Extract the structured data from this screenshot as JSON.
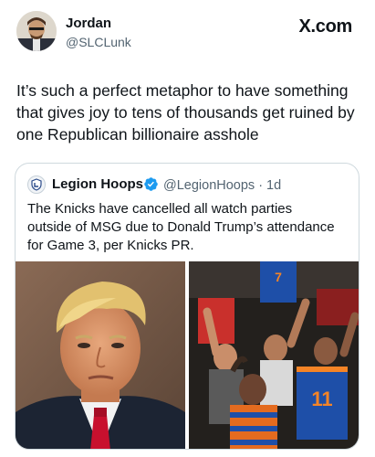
{
  "header": {
    "name": "Jordan",
    "handle": "@SLCLunk",
    "brand": "X.com"
  },
  "post": {
    "text": "It’s such a perfect metaphor to have something that gives joy to tens of thousands get ruined by one Republican billionaire asshole"
  },
  "quote": {
    "name": "Legion Hoops",
    "handle_time": "@LegionHoops · 1d",
    "text": "The Knicks have cancelled all watch parties outside of MSG due to Donald Trump’s attendance for Game 3, per Knicks PR.",
    "verified_color": "#1d9bf0"
  },
  "media": {
    "right_jersey_number": "11",
    "top_jersey_number": "7"
  }
}
